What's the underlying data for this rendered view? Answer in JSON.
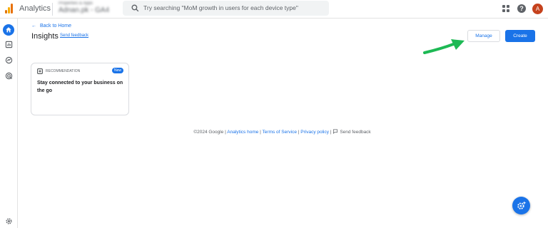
{
  "header": {
    "app_name": "Analytics",
    "property_line1": "Properties & Apps",
    "property_line2": "Adnan.pk - GA4",
    "search_placeholder": "Try searching \"MoM growth in users for each device type\"",
    "avatar_initial": "A",
    "help_glyph": "?"
  },
  "page": {
    "back_label": "Back to Home",
    "title": "Insights",
    "send_feedback_link": "Send feedback",
    "manage_label": "Manage",
    "create_label": "Create"
  },
  "card": {
    "type_label": "RECOMMENDATION",
    "badge": "New",
    "text": "Stay connected to your business on the go"
  },
  "footer": {
    "copyright": "©2024 Google",
    "sep": " | ",
    "analytics_home": "Analytics home",
    "terms": "Terms of Service",
    "privacy": "Privacy policy",
    "feedback": "Send feedback"
  },
  "nav": {
    "items": [
      "home-icon",
      "reports-icon",
      "explore-icon",
      "advertising-icon"
    ],
    "bottom": "settings-icon"
  },
  "colors": {
    "accent": "#1a73e8",
    "arrow": "#1db954",
    "avatar": "#c5421d"
  }
}
